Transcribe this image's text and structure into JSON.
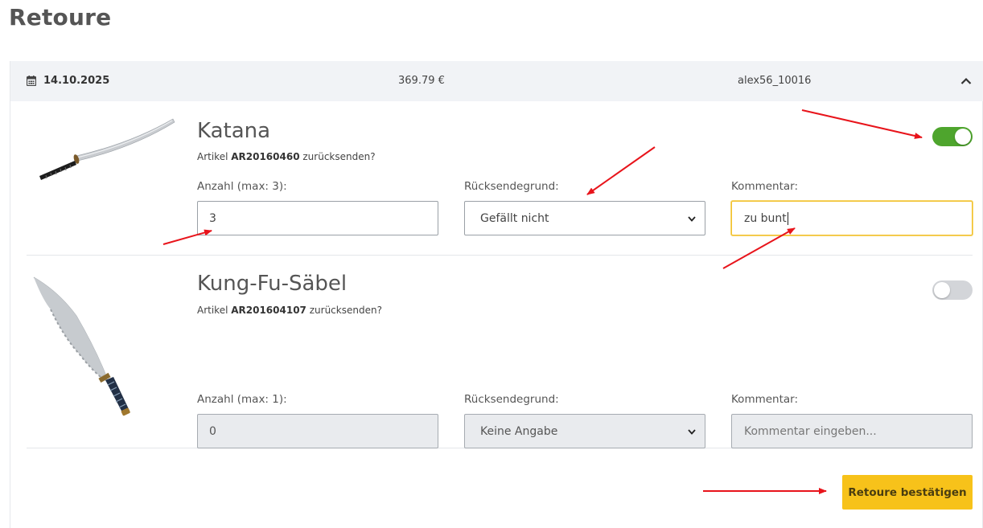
{
  "page": {
    "title": "Retoure"
  },
  "order": {
    "date": "14.10.2025",
    "total": "369.79 €",
    "customer": "alex56_10016"
  },
  "items": [
    {
      "name": "Katana",
      "sub_prefix": "Artikel ",
      "article": "AR20160460",
      "sub_suffix": " zurücksenden?",
      "quantity_label": "Anzahl (max: 3):",
      "quantity_value": "3",
      "reason_label": "Rücksendegrund:",
      "reason_value": "Gefällt nicht",
      "comment_label": "Kommentar:",
      "comment_value": "zu bunt",
      "toggle_on": true
    },
    {
      "name": "Kung-Fu-Säbel",
      "sub_prefix": "Artikel ",
      "article": "AR201604107",
      "sub_suffix": " zurücksenden?",
      "quantity_label": "Anzahl (max: 1):",
      "quantity_value": "0",
      "reason_label": "Rücksendegrund:",
      "reason_value": "Keine Angabe",
      "comment_label": "Kommentar:",
      "comment_placeholder": "Kommentar eingeben...",
      "toggle_on": false
    }
  ],
  "actions": {
    "confirm_label": "Retoure bestätigen"
  },
  "icons": {
    "date": "calendar-icon",
    "collapse": "chevron-up-icon",
    "select": "chevron-down-icon"
  },
  "colors": {
    "toggle_on": "#4ea52d",
    "toggle_off": "#d3d5d9",
    "confirm_button": "#f7c21a",
    "focus_border": "#f2c12e",
    "annotation_arrows": "#e8141b"
  }
}
